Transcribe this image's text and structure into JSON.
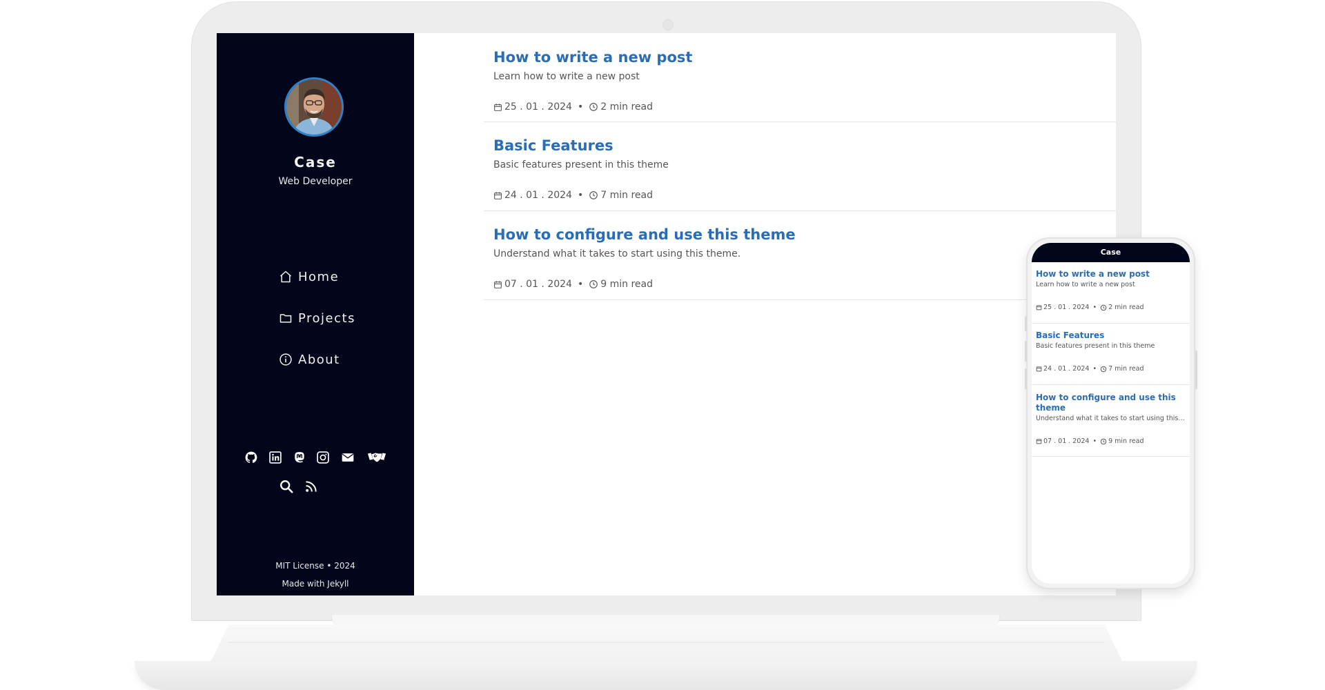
{
  "sidebar": {
    "name": "Case",
    "role": "Web Developer",
    "nav": [
      {
        "label": "Home",
        "icon": "home-icon"
      },
      {
        "label": "Projects",
        "icon": "folder-icon"
      },
      {
        "label": "About",
        "icon": "info-icon"
      }
    ],
    "socials": [
      "github-icon",
      "linkedin-icon",
      "mastodon-icon",
      "instagram-icon",
      "email-icon",
      "handshake-icon",
      "search-icon",
      "rss-icon"
    ],
    "footer": {
      "license": "MIT License • 2024",
      "made_with": "Made with Jekyll"
    }
  },
  "posts": [
    {
      "title": "How to write a new post",
      "description": "Learn how to write a new post",
      "date": "25 . 01 . 2024",
      "read_time": "2 min read"
    },
    {
      "title": "Basic Features",
      "description": "Basic features present in this theme",
      "date": "24 . 01 . 2024",
      "read_time": "7 min read"
    },
    {
      "title": "How to configure and use this theme",
      "description": "Understand what it takes to start using this theme.",
      "date": "07 . 01 . 2024",
      "read_time": "9 min read"
    }
  ],
  "meta_separator": "•",
  "mobile": {
    "header_title": "Case"
  },
  "colors": {
    "sidebar_bg": "#03061b",
    "link": "#2a6db4",
    "avatar_ring": "#2f82c9"
  }
}
